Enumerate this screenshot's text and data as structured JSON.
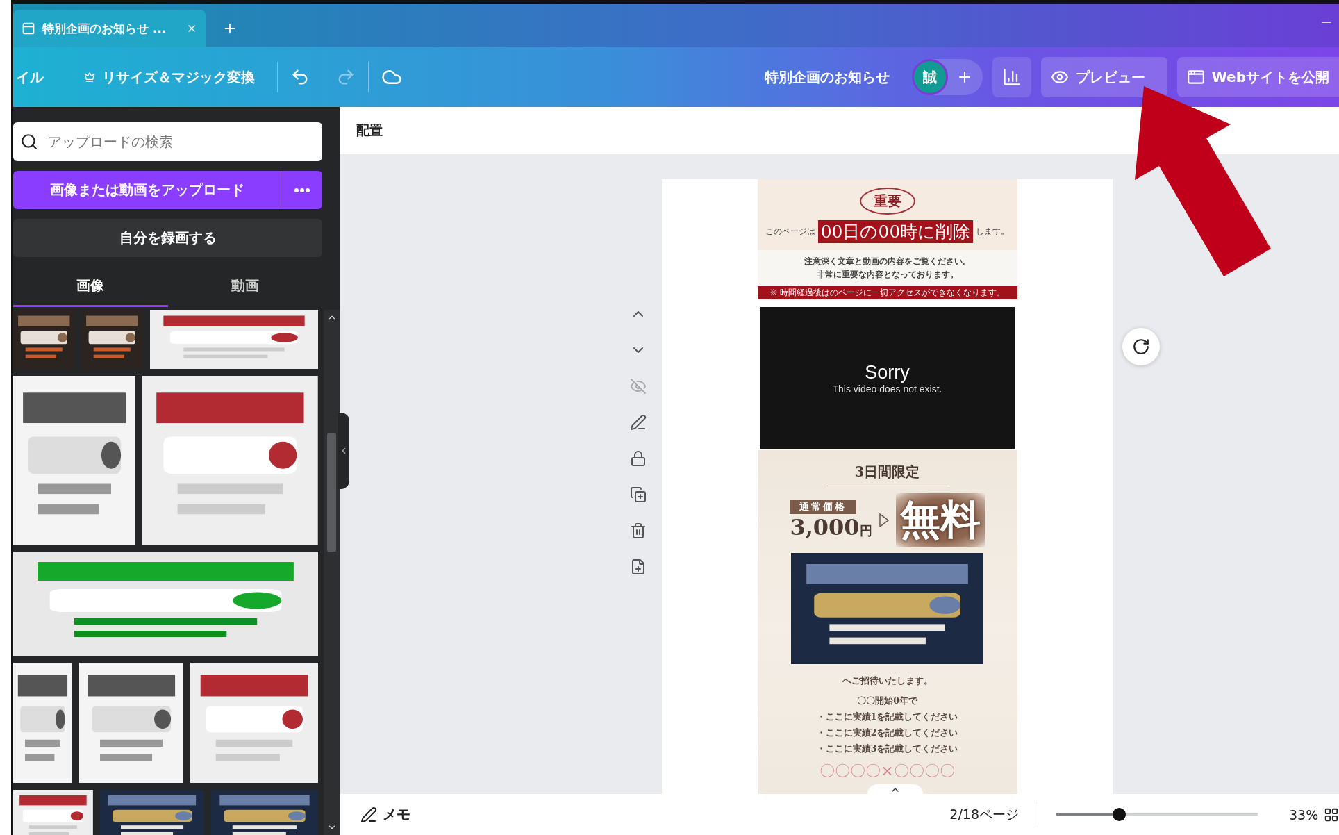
{
  "browser_tab": {
    "title": "特別企画のお知らせ ...",
    "selected": true
  },
  "toolbar": {
    "menu": "イル",
    "resize": "リサイズ＆マジック変換",
    "redo_disabled": true,
    "document_title": "特別企画のお知らせ",
    "avatar": "誠",
    "preview": "プレビュー",
    "publish": "Webサイトを公開"
  },
  "sidebar": {
    "search": {
      "placeholder": "アップロードの検索"
    },
    "upload_button": "画像または動画をアップロード",
    "record_button": "自分を録画する",
    "tabs": [
      {
        "label": "画像",
        "selected": true
      },
      {
        "label": "動画",
        "selected": false
      }
    ]
  },
  "canvas_header": "配置",
  "design": {
    "notice": {
      "badge": "重要",
      "lead": "このページは",
      "highlight": "00日の00時に削除",
      "tail": "します。",
      "notes": [
        "注意深く文章と動画の内容をご覧ください。",
        "非常に重要な内容となっております。"
      ],
      "warning": "※ 時間経過後はのページに一切アクセスができなくなります。"
    },
    "video": {
      "title": "Sorry",
      "message": "This video does not exist."
    },
    "offer": {
      "heading": "3日間限定",
      "price_label": "通常価格",
      "price": "3,000",
      "currency": "円",
      "free": "無料",
      "invite": "へご招待いたします。",
      "intro": "〇〇開始0年で",
      "achievements": [
        "・ここに実績1を記載してください",
        "・ここに実績2を記載してください",
        "・ここに実績3を記載してください"
      ],
      "names": "〇〇〇〇×〇〇〇〇"
    }
  },
  "footer": {
    "notes": "メモ",
    "page": "2/18ページ",
    "zoom": {
      "level": 0.3,
      "reading": "33%"
    }
  }
}
